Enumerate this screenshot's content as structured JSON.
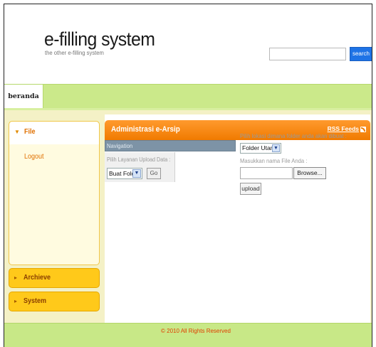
{
  "header": {
    "logo_title": "e-filling system",
    "logo_subtitle": "the other e-filling system",
    "search_value": "",
    "search_button": "search"
  },
  "nav": {
    "tab": "beranda"
  },
  "sidebar": {
    "file": "File",
    "logout": "Logout",
    "archieve": "Archieve",
    "system": "System"
  },
  "content": {
    "title": "Administrasi e-Arsip",
    "rss": "RSS Feeds",
    "navigation": "Navigation",
    "service_label": "Pilih Layanan Upload Data :",
    "service_selected": "Buat Folder",
    "go_button": "Go",
    "location_label": "Pilih lokasi dimana folder anda akan dibuat :",
    "folder_selected": "Folder Utama",
    "name_label": "Masukkan nama File Anda :",
    "file_value": "",
    "browse_button": "Browse...",
    "upload_button": "upload"
  },
  "footer": {
    "text": "© 2010 All Rights Reserved"
  },
  "colors": {
    "accent_orange": "#f07a00",
    "nav_green": "#cbe98a",
    "accordion_yellow": "#ffc91a",
    "search_blue": "#1e73e6"
  }
}
